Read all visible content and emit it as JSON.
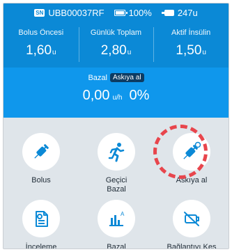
{
  "status": {
    "serial_tag": "SN",
    "serial": "UBB00037RF",
    "battery": "100%",
    "reservoir": "247u"
  },
  "stats": [
    {
      "label": "Bolus Öncesi",
      "value": "1,60",
      "unit": "u"
    },
    {
      "label": "Günlük Toplam",
      "value": "2,80",
      "unit": "u"
    },
    {
      "label": "Aktif İnsülin",
      "value": "1,50",
      "unit": "u"
    }
  ],
  "basal": {
    "label": "Bazal",
    "badge": "Askıya al",
    "rate": "0,00",
    "rate_unit": "u/h",
    "percent": "0%"
  },
  "menu": [
    {
      "label": "Bolus",
      "icon": "syringe-icon"
    },
    {
      "label": "Geçici Bazal",
      "icon": "running-person-icon"
    },
    {
      "label": "Askıya al",
      "icon": "syringe-paused-icon",
      "highlighted": true
    },
    {
      "label": "İnceleme",
      "icon": "document-search-icon"
    },
    {
      "label": "Bazal",
      "icon": "bar-chart-icon"
    },
    {
      "label": "Bağlantıyı Kes",
      "icon": "disconnect-icon"
    }
  ],
  "colors": {
    "primary_blue": "#0b89d6",
    "basal_blue": "#0f97ec",
    "badge_navy": "#0d3b62",
    "highlight_red": "#e8454c",
    "grid_bg": "#dfe5ea"
  }
}
